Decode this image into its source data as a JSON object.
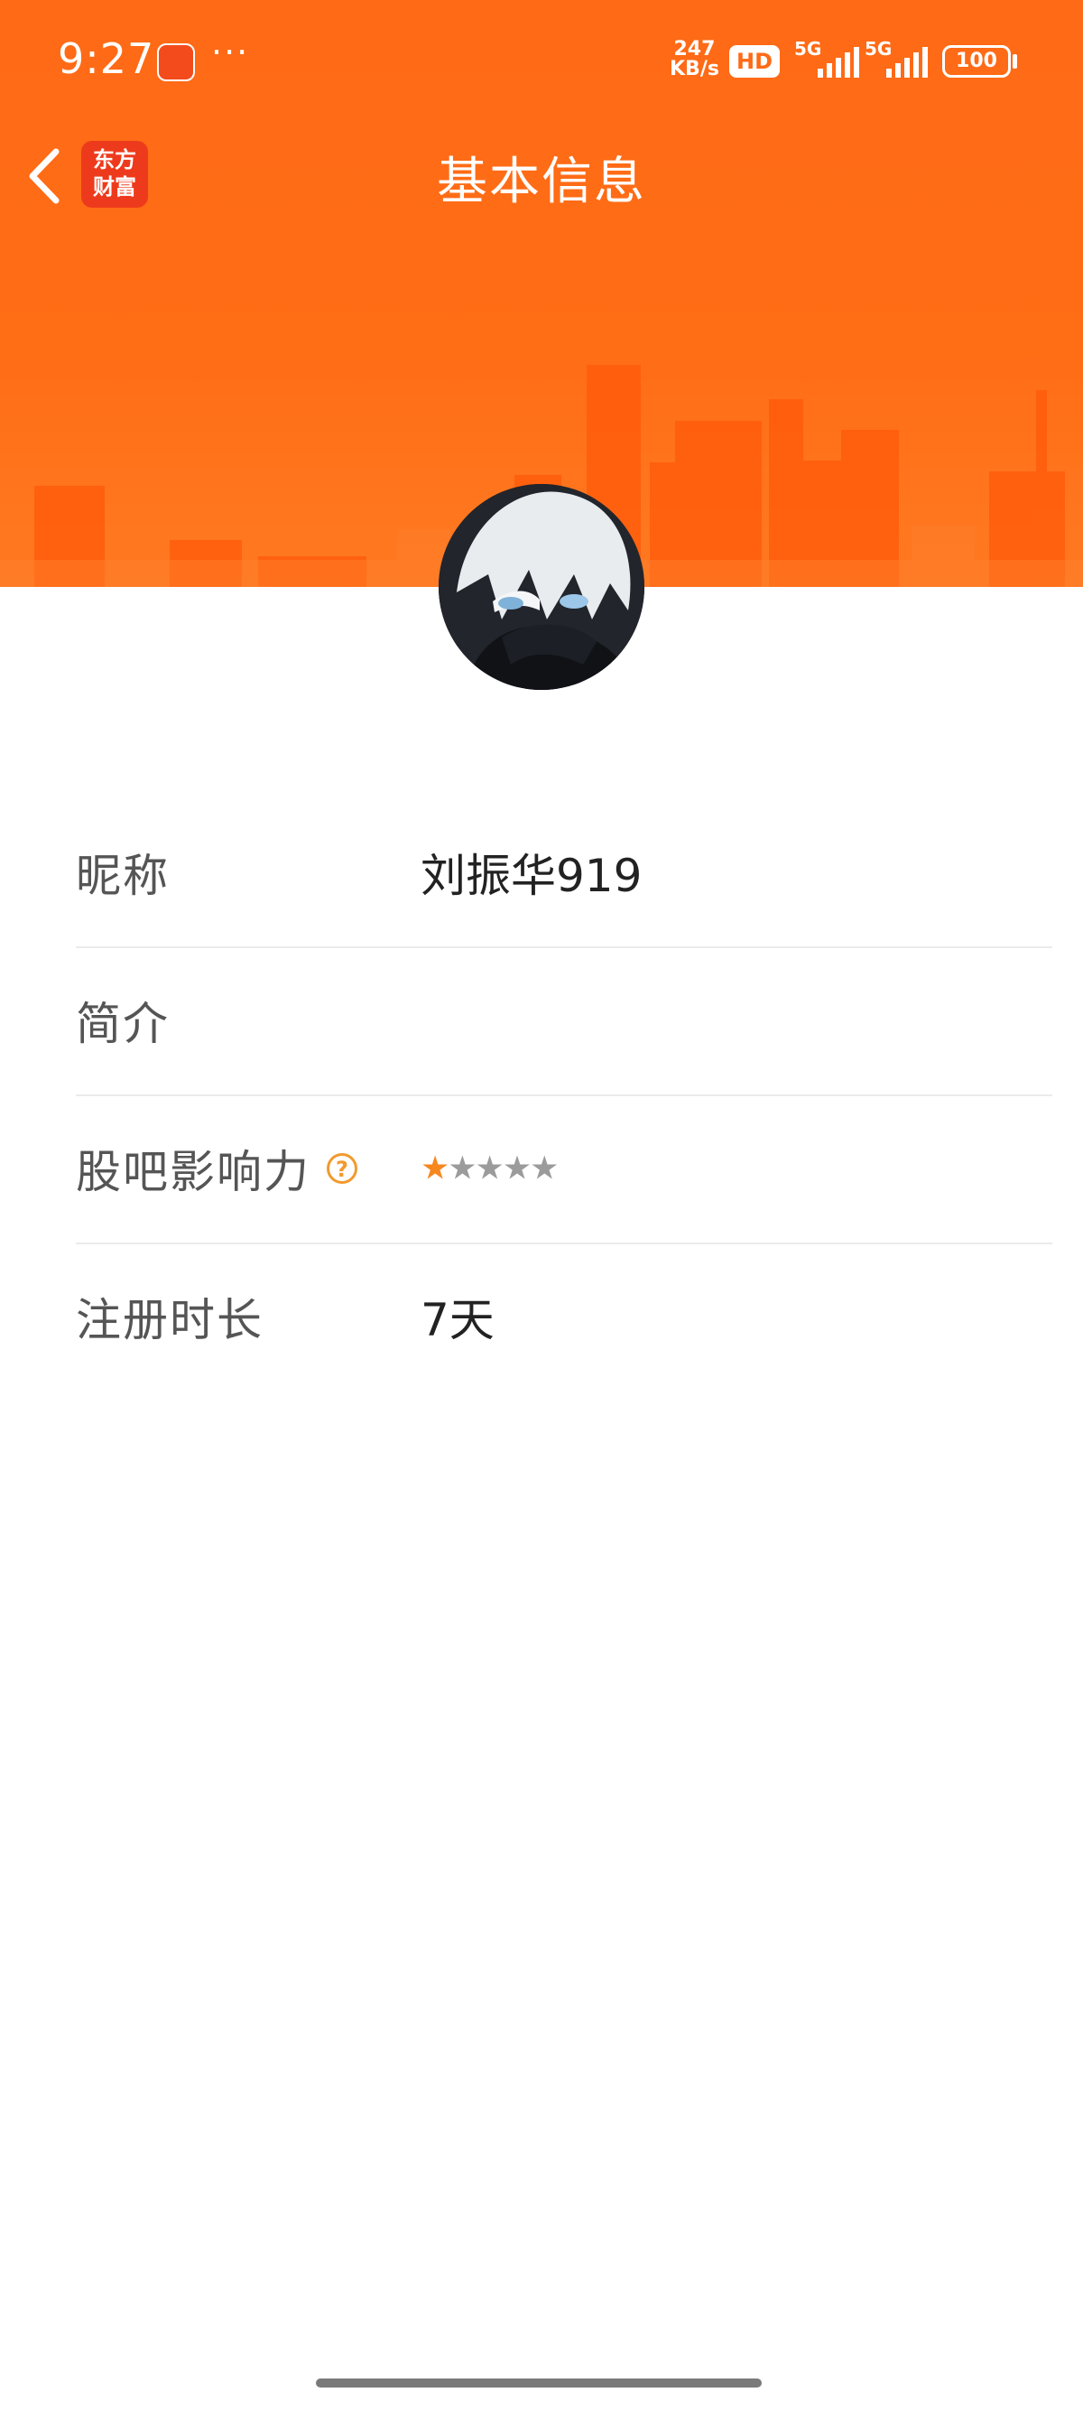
{
  "status_bar": {
    "time": "9:27",
    "more": "···",
    "net_speed_value": "247",
    "net_speed_unit": "KB/s",
    "hd_label": "HD",
    "sim1_label": "5G",
    "sim2_label": "5G",
    "battery": "100"
  },
  "nav": {
    "back_icon": "chevron-left-icon",
    "logo_line1": "东方",
    "logo_line2": "财富",
    "title": "基本信息"
  },
  "colors": {
    "header_orange": "#ff6a16",
    "star_active": "#f7871f",
    "help_icon": "#f29a2e"
  },
  "profile": {
    "avatar_icon": "user-avatar"
  },
  "rows": [
    {
      "label": "昵称",
      "value": "刘振华919"
    },
    {
      "label": "简介",
      "value": ""
    },
    {
      "label": "股吧影响力",
      "help": "?",
      "stars_filled": 1,
      "stars_total": 5
    },
    {
      "label": "注册时长",
      "value": "7天"
    }
  ],
  "stars": {
    "on": "★",
    "off": "★★★★"
  }
}
